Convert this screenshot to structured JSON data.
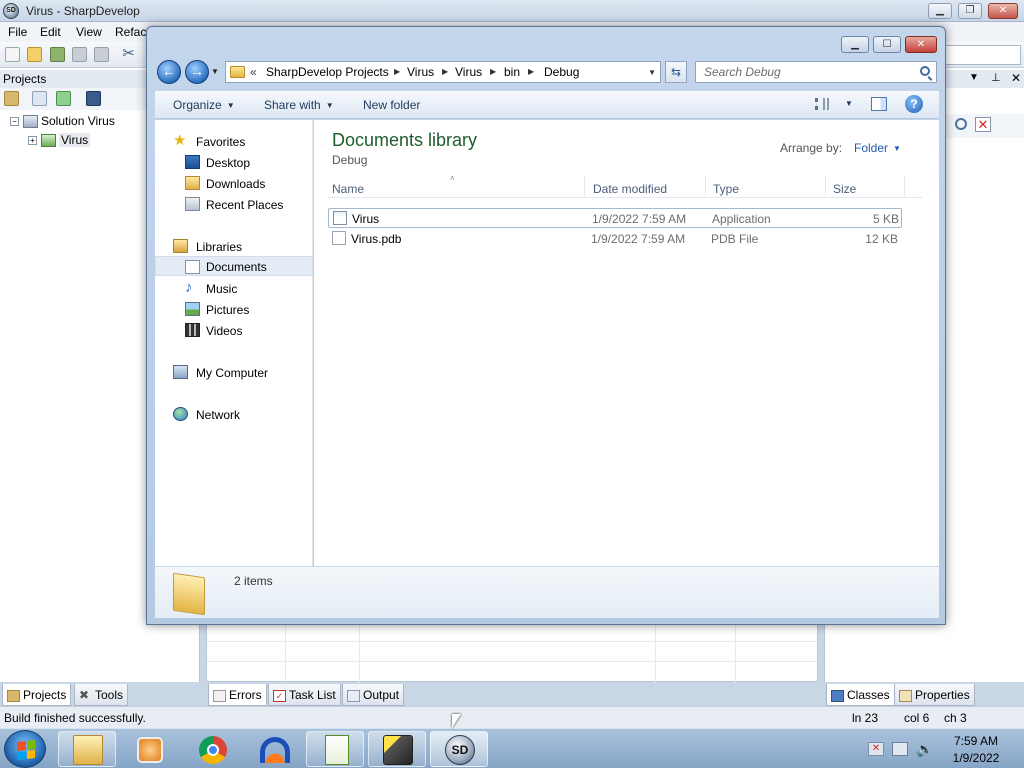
{
  "ide": {
    "title": "Virus - SharpDevelop",
    "menu": [
      "File",
      "Edit",
      "View",
      "Refact"
    ],
    "projects_panel": {
      "header": "Projects",
      "tree": [
        {
          "label": "Solution Virus",
          "expander": "−"
        },
        {
          "label": "Virus",
          "expander": "+"
        }
      ]
    },
    "bottom_tabs_left": [
      "Projects",
      "Tools"
    ],
    "bottom_tabs_center": [
      "Errors",
      "Task List",
      "Output"
    ],
    "bottom_tabs_right": [
      "Classes",
      "Properties"
    ],
    "status": {
      "message": "Build finished successfully.",
      "line": "ln 23",
      "col": "col 6",
      "ch": "ch 3"
    }
  },
  "explorer": {
    "address": {
      "chevrons": "«",
      "crumbs": [
        "SharpDevelop Projects",
        "Virus",
        "Virus",
        "bin",
        "Debug"
      ]
    },
    "search_placeholder": "Search Debug",
    "commands": {
      "organize": "Organize",
      "share_with": "Share with",
      "new_folder": "New folder"
    },
    "nav": {
      "favorites": "Favorites",
      "desktop": "Desktop",
      "downloads": "Downloads",
      "recent_places": "Recent Places",
      "libraries": "Libraries",
      "documents": "Documents",
      "music": "Music",
      "pictures": "Pictures",
      "videos": "Videos",
      "my_computer": "My Computer",
      "network": "Network"
    },
    "library": {
      "title": "Documents library",
      "subtitle": "Debug",
      "arrange_label": "Arrange by:",
      "arrange_value": "Folder"
    },
    "columns": {
      "name": "Name",
      "date": "Date modified",
      "type": "Type",
      "size": "Size"
    },
    "files": [
      {
        "name": "Virus",
        "date": "1/9/2022 7:59 AM",
        "type": "Application",
        "size": "5 KB"
      },
      {
        "name": "Virus.pdb",
        "date": "1/9/2022 7:59 AM",
        "type": "PDB File",
        "size": "12 KB"
      }
    ],
    "item_count": "2 items"
  },
  "taskbar": {
    "time": "7:59 AM",
    "date": "1/9/2022",
    "sd_badge": "SD"
  },
  "colors": {
    "library_title": "#1e5e2c",
    "link_blue": "#1f5fb0"
  }
}
